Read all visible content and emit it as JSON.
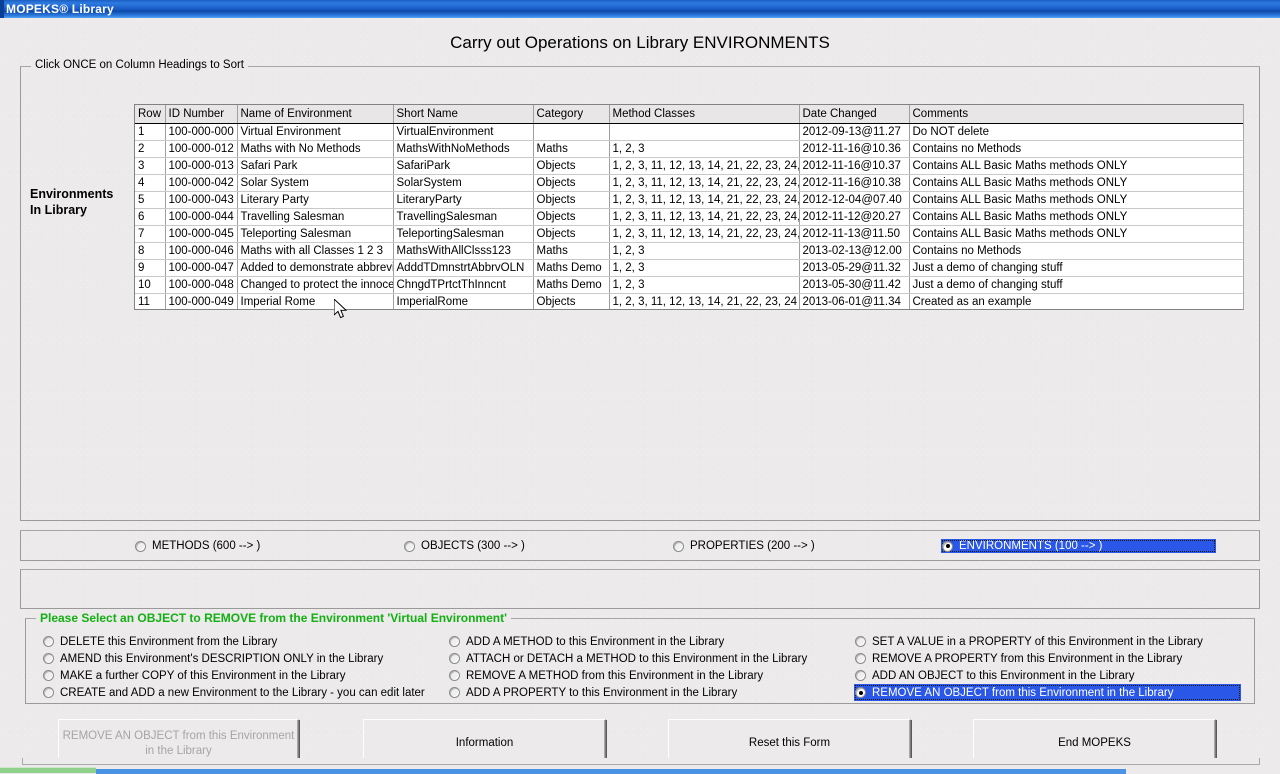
{
  "window": {
    "title": "MOPEKS® Library"
  },
  "header": {
    "page_title": "Carry out Operations on Library ENVIRONMENTS"
  },
  "grid_group": {
    "legend": "Click ONCE on Column Headings to Sort",
    "side_label_line1": "Environments",
    "side_label_line2": "In Library"
  },
  "grid": {
    "columns": [
      "Row",
      "ID Number",
      "Name of Environment",
      "Short Name",
      "Category",
      "Method Classes",
      "Date Changed",
      "Comments"
    ],
    "rows": [
      {
        "row": "1",
        "id": "100-000-000",
        "name": "Virtual Environment",
        "short": "VirtualEnvironment",
        "category": "",
        "method_classes": "",
        "date": "2012-09-13@11.27",
        "comments": "Do NOT delete"
      },
      {
        "row": "2",
        "id": "100-000-012",
        "name": "Maths with No Methods",
        "short": "MathsWithNoMethods",
        "category": "Maths",
        "method_classes": "1, 2, 3",
        "date": "2012-11-16@10.36",
        "comments": "Contains no Methods"
      },
      {
        "row": "3",
        "id": "100-000-013",
        "name": "Safari Park",
        "short": "SafariPark",
        "category": "Objects",
        "method_classes": "1, 2, 3, 11, 12, 13, 14, 21, 22, 23, 24,",
        "date": "2012-11-16@10.37",
        "comments": "Contains ALL Basic Maths methods ONLY"
      },
      {
        "row": "4",
        "id": "100-000-042",
        "name": "Solar System",
        "short": "SolarSystem",
        "category": "Objects",
        "method_classes": "1, 2, 3, 11, 12, 13, 14, 21, 22, 23, 24,",
        "date": "2012-11-16@10.38",
        "comments": "Contains ALL Basic Maths methods ONLY"
      },
      {
        "row": "5",
        "id": "100-000-043",
        "name": "Literary Party",
        "short": "LiteraryParty",
        "category": "Objects",
        "method_classes": "1, 2, 3, 11, 12, 13, 14, 21, 22, 23, 24,",
        "date": "2012-12-04@07.40",
        "comments": "Contains ALL Basic Maths methods ONLY"
      },
      {
        "row": "6",
        "id": "100-000-044",
        "name": "Travelling Salesman",
        "short": "TravellingSalesman",
        "category": "Objects",
        "method_classes": "1, 2, 3, 11, 12, 13, 14, 21, 22, 23, 24,",
        "date": "2012-11-12@20.27",
        "comments": "Contains ALL Basic Maths methods ONLY"
      },
      {
        "row": "7",
        "id": "100-000-045",
        "name": "Teleporting Salesman",
        "short": "TeleportingSalesman",
        "category": "Objects",
        "method_classes": "1, 2, 3, 11, 12, 13, 14, 21, 22, 23, 24,",
        "date": "2012-11-13@11.50",
        "comments": "Contains ALL Basic Maths methods ONLY"
      },
      {
        "row": "8",
        "id": "100-000-046",
        "name": "Maths with all Classes 1 2 3",
        "short": "MathsWithAllClsss123",
        "category": "Maths",
        "method_classes": "1, 2, 3",
        "date": "2013-02-13@12.00",
        "comments": "Contains no Methods"
      },
      {
        "row": "9",
        "id": "100-000-047",
        "name": "Added to demonstrate abbrevia",
        "short": "AdddTDmnstrtAbbrvOLN",
        "category": "Maths Demo",
        "method_classes": "1, 2, 3",
        "date": "2013-05-29@11.32",
        "comments": "Just a demo of changing stuff"
      },
      {
        "row": "10",
        "id": "100-000-048",
        "name": "Changed to protect the innocen",
        "short": "ChngdTPrtctThInncnt",
        "category": "Maths Demo",
        "method_classes": "1, 2, 3",
        "date": "2013-05-30@11.42",
        "comments": "Just a demo of changing stuff"
      },
      {
        "row": "11",
        "id": "100-000-049",
        "name": "Imperial Rome",
        "short": "ImperialRome",
        "category": "Objects",
        "method_classes": "1, 2, 3, 11, 12, 13, 14, 21, 22, 23, 24",
        "date": "2013-06-01@11.34",
        "comments": "Created as an example"
      }
    ]
  },
  "library_type": {
    "options": [
      {
        "label": "METHODS (600 --> )",
        "selected": false
      },
      {
        "label": "OBJECTS (300 --> )",
        "selected": false
      },
      {
        "label": "PROPERTIES (200 --> )",
        "selected": false
      },
      {
        "label": "ENVIRONMENTS (100 --> )",
        "selected": true
      }
    ]
  },
  "operations": {
    "legend": "Please Select an OBJECT to REMOVE from the Environment 'Virtual Environment'",
    "column1": [
      "DELETE this Environment from the Library",
      "AMEND this Environment's DESCRIPTION ONLY in the Library",
      "MAKE a further COPY of this Environment in the Library",
      "CREATE and ADD a new Environment to the Library - you can edit later"
    ],
    "column2": [
      "ADD A METHOD to this Environment in the Library",
      "ATTACH or DETACH a METHOD to this Environment in the Library",
      "REMOVE A METHOD from this Environment in the Library",
      "ADD A PROPERTY to this Environment in the Library"
    ],
    "column3": [
      "SET A VALUE in a PROPERTY of this Environment in the Library",
      "REMOVE A PROPERTY from this Environment in the Library",
      "ADD AN OBJECT to this Environment in the Library",
      "REMOVE  AN OBJECT from this Environment in the Library"
    ],
    "selected_column": 3,
    "selected_index": 3
  },
  "buttons": {
    "action": "REMOVE AN OBJECT from this Environment in the Library",
    "information": "Information",
    "reset": "Reset this Form",
    "end": "End MOPEKS"
  },
  "colors": {
    "titlebar_blue": "#1a5ec9",
    "selection_blue": "#2a57e8",
    "legend_green": "#12b012",
    "progress_green": "#8fd18b",
    "progress_blue": "#4a92e4"
  }
}
